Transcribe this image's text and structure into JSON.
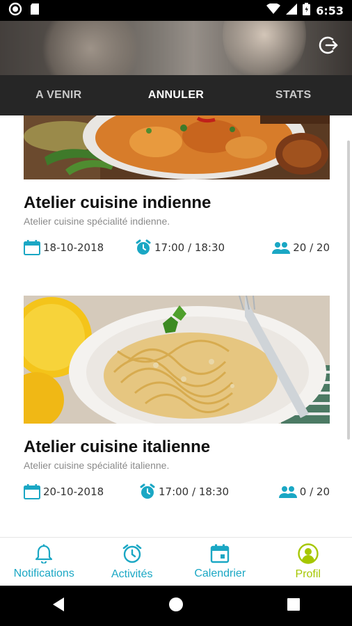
{
  "status_bar": {
    "time": "6:53"
  },
  "tabs": [
    {
      "label": "A VENIR"
    },
    {
      "label": "ANNULER"
    },
    {
      "label": "STATS"
    }
  ],
  "cards": [
    {
      "title": "Atelier cuisine indienne",
      "subtitle": "Atelier cuisine spécialité indienne.",
      "date": "18-10-2018",
      "time": "17:00 / 18:30",
      "places": "20 / 20"
    },
    {
      "title": "Atelier cuisine italienne",
      "subtitle": "Atelier cuisine spécialité italienne.",
      "date": "20-10-2018",
      "time": "17:00 / 18:30",
      "places": "0 / 20"
    }
  ],
  "bottom_nav": [
    {
      "label": "Notifications",
      "icon": "bell-icon"
    },
    {
      "label": "Activités",
      "icon": "alarm-clock-icon"
    },
    {
      "label": "Calendrier",
      "icon": "calendar-icon"
    },
    {
      "label": "Profil",
      "icon": "profile-icon"
    }
  ],
  "colors": {
    "accent": "#1aa7c4",
    "active_nav": "#a6c700",
    "tab_bar": "#262626"
  }
}
